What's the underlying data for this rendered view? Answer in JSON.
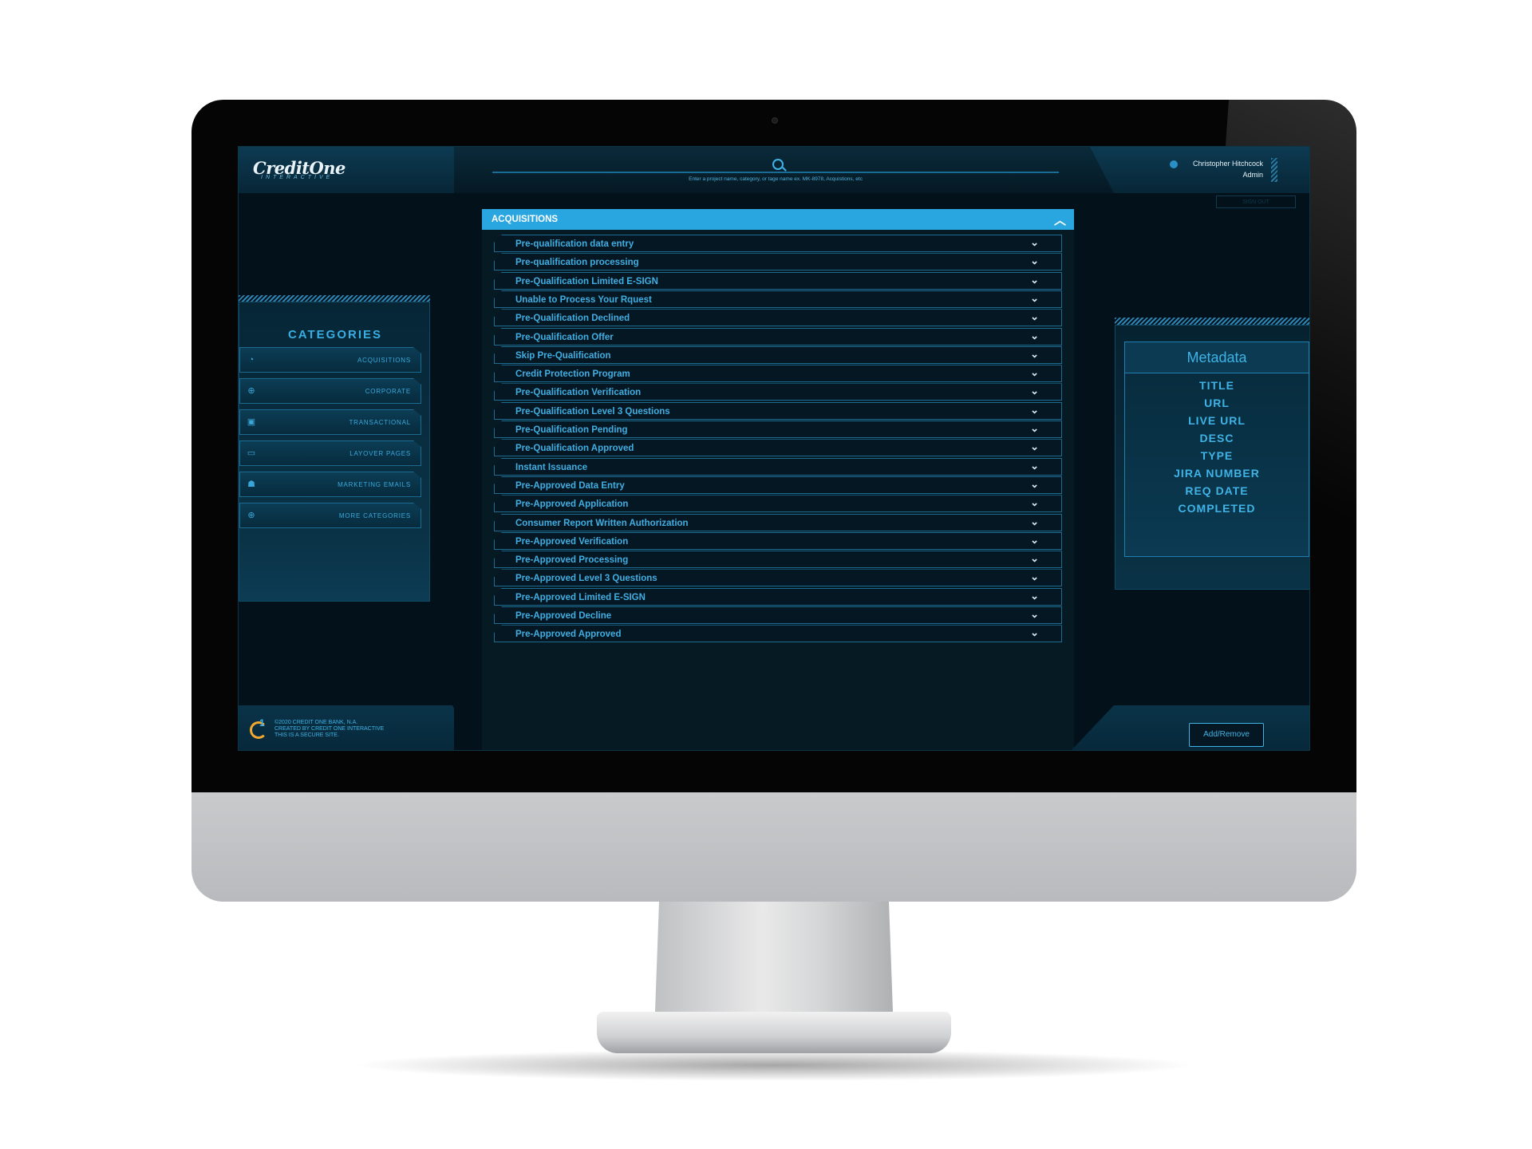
{
  "header": {
    "logo": "CreditOne",
    "logo_sub": "INTERACTIVE",
    "search_placeholder": "Enter a project name, category, or tage name ex. MK-8978, Acquistions, etc",
    "user_name": "Christopher Hitchcock",
    "user_role": "Admin",
    "sign_out": "SIGN OUT"
  },
  "categories": {
    "title": "CATEGORIES",
    "items": [
      {
        "label": "ACQUISITIONS",
        "icon": "gauge-icon"
      },
      {
        "label": "CORPORATE",
        "icon": "globe-icon"
      },
      {
        "label": "TRANSACTIONAL",
        "icon": "briefcase-icon"
      },
      {
        "label": "LAYOVER PAGES",
        "icon": "card-icon"
      },
      {
        "label": "MARKETING EMAILS",
        "icon": "bank-icon"
      },
      {
        "label": "MORE CATEGORIES",
        "icon": "plus-circle-icon"
      }
    ]
  },
  "main": {
    "section_title": "ACQUISITIONS",
    "items": [
      "Pre-qualification data entry",
      "Pre-qualification processing",
      "Pre-Qualification Limited E-SIGN",
      "Unable to Process Your Rquest",
      "Pre-Qualification Declined",
      "Pre-Qualification Offer",
      "Skip Pre-Qualification",
      "Credit Protection Program",
      "Pre-Qualification Verification",
      "Pre-Qualification Level 3 Questions",
      "Pre-Qualification Pending",
      "Pre-Qualification Approved",
      "Instant Issuance",
      "Pre-Approved Data Entry",
      "Pre-Approved Application",
      "Consumer Report Written Authorization",
      "Pre-Approved Verification",
      "Pre-Approved Processing",
      "Pre-Approved Level 3 Questions",
      "Pre-Approved Limited E-SIGN",
      "Pre-Approved Decline",
      "Pre-Approved Approved"
    ]
  },
  "metadata": {
    "title": "Metadata",
    "fields": [
      "TITLE",
      "URL",
      "LIVE URL",
      "DESC",
      "TYPE",
      "JIRA NUMBER",
      "REQ DATE",
      "COMPLETED"
    ]
  },
  "footer": {
    "line1": "©2020 CREDIT ONE BANK, N.A.",
    "line2": "CREATED BY CREDIT ONE INTERACTIVE",
    "line3": "THIS IS A SECURE SITE.",
    "add_remove": "Add/Remove"
  },
  "colors": {
    "accent": "#29a6e0",
    "text_blue": "#40aee2",
    "background": "#03121a"
  }
}
